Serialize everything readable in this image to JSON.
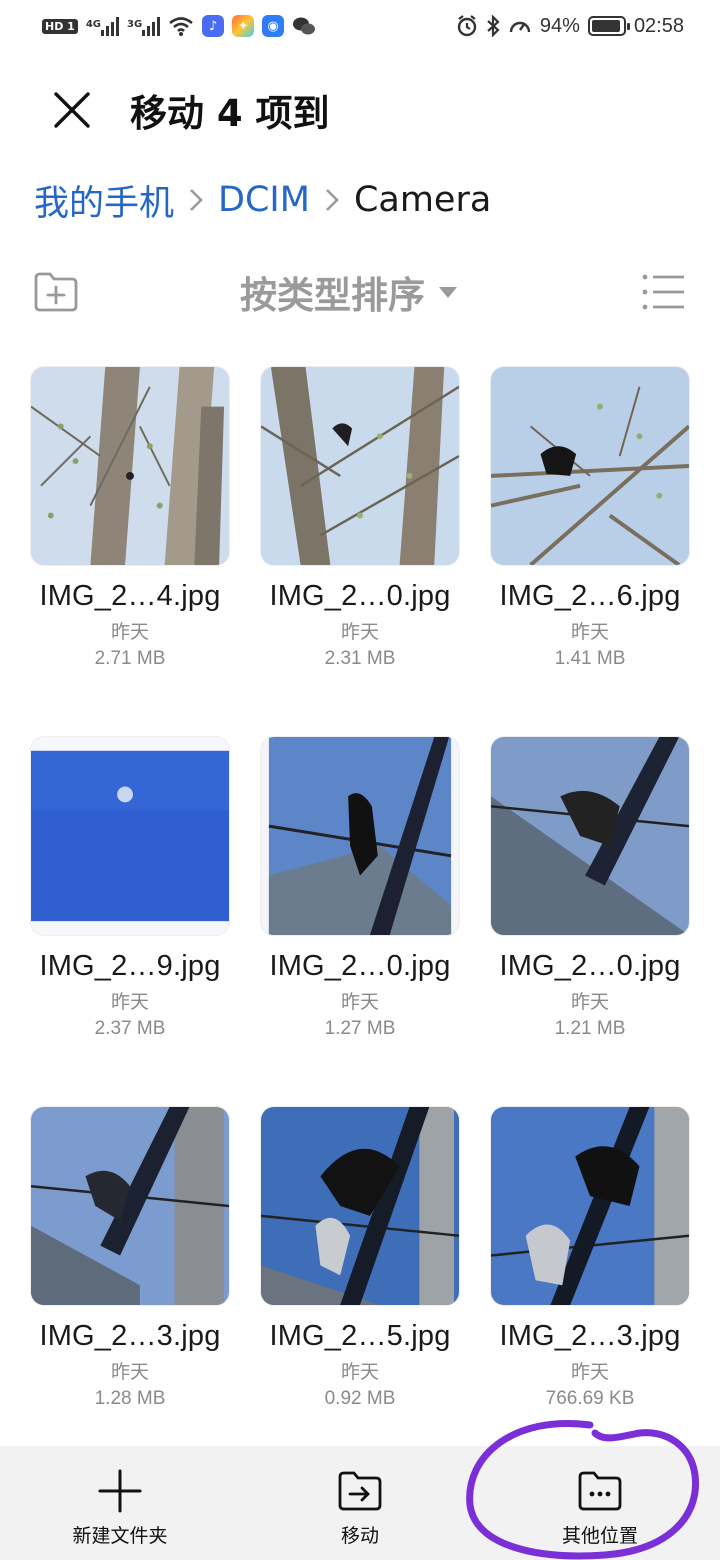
{
  "status_bar": {
    "hd_badge": "HD 1",
    "net1": "4G",
    "net2": "3G",
    "battery_text": "94%",
    "battery_level": 0.94,
    "time": "02:58",
    "icons": [
      "wifi-icon",
      "music-app-icon",
      "colorful-app-icon",
      "bulb-app-icon",
      "wechat-icon",
      "alarm-icon",
      "bluetooth-icon",
      "speed-icon"
    ]
  },
  "header": {
    "title": "移动 4 项到"
  },
  "breadcrumb": {
    "items": [
      "我的手机",
      "DCIM"
    ],
    "current": "Camera"
  },
  "toolbar": {
    "sort_label": "按类型排序"
  },
  "files": [
    {
      "name": "IMG_2…4.jpg",
      "date": "昨天",
      "size": "2.71 MB"
    },
    {
      "name": "IMG_2…0.jpg",
      "date": "昨天",
      "size": "2.31 MB"
    },
    {
      "name": "IMG_2…6.jpg",
      "date": "昨天",
      "size": "1.41 MB"
    },
    {
      "name": "IMG_2…9.jpg",
      "date": "昨天",
      "size": "2.37 MB"
    },
    {
      "name": "IMG_2…0.jpg",
      "date": "昨天",
      "size": "1.27 MB"
    },
    {
      "name": "IMG_2…0.jpg",
      "date": "昨天",
      "size": "1.21 MB"
    },
    {
      "name": "IMG_2…3.jpg",
      "date": "昨天",
      "size": "1.28 MB"
    },
    {
      "name": "IMG_2…5.jpg",
      "date": "昨天",
      "size": "0.92 MB"
    },
    {
      "name": "IMG_2…3.jpg",
      "date": "昨天",
      "size": "766.69 KB"
    }
  ],
  "bottom_bar": {
    "new_folder": "新建文件夹",
    "move": "移动",
    "other_location": "其他位置"
  },
  "colors": {
    "link": "#2567c9",
    "annotation": "#7b2fd6"
  }
}
